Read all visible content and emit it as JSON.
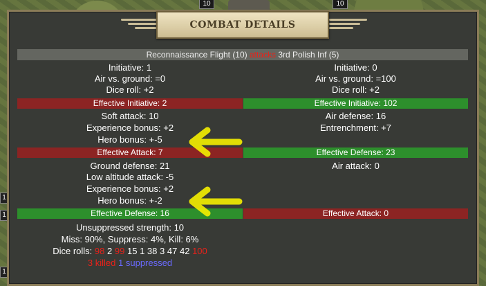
{
  "map": {
    "counters_top": [
      "10",
      "10"
    ],
    "side_counters": [
      "1",
      "1",
      "1"
    ]
  },
  "window": {
    "title": "COMBAT DETAILS"
  },
  "header": {
    "attacker": "Reconnaissance Flight (10)",
    "verb": "attacks",
    "defender": "3rd Polish Inf (5)"
  },
  "left": {
    "initiative": "Initiative: 1",
    "air_vs_ground": "Air vs. ground: =0",
    "dice_roll": "Dice roll: +2",
    "effective_initiative": "Effective Initiative: 2",
    "soft_attack": "Soft attack: 10",
    "experience_bonus": "Experience bonus: +2",
    "hero_bonus": "Hero bonus: +-5",
    "effective_attack": "Effective Attack: 7",
    "ground_defense": "Ground defense: 21",
    "low_altitude_attack": "Low altitude attack: -5",
    "experience_bonus_2": "Experience bonus: +2",
    "hero_bonus_2": "Hero bonus: +-2",
    "effective_defense": "Effective Defense: 16"
  },
  "right": {
    "initiative": "Initiative: 0",
    "air_vs_ground": "Air vs. ground: =100",
    "dice_roll": "Dice roll: +2",
    "effective_initiative": "Effective Initiative: 102",
    "air_defense": "Air defense: 16",
    "entrenchment": "Entrenchment: +7",
    "effective_defense": "Effective Defense: 23",
    "air_attack": "Air attack: 0",
    "effective_attack": "Effective Attack: 0"
  },
  "summary": {
    "unsuppressed": "Unsuppressed strength: 10",
    "odds": "Miss: 90%, Suppress: 4%, Kill: 6%",
    "dice_label": "Dice rolls:",
    "dice": [
      {
        "v": "98",
        "hit": true
      },
      {
        "v": "2",
        "hit": false
      },
      {
        "v": "99",
        "hit": true
      },
      {
        "v": "15",
        "hit": false
      },
      {
        "v": "1",
        "hit": false
      },
      {
        "v": "38",
        "hit": false
      },
      {
        "v": "3",
        "hit": false
      },
      {
        "v": "47",
        "hit": false
      },
      {
        "v": "42",
        "hit": false
      },
      {
        "v": "100",
        "hit": true
      }
    ],
    "killed": "3 killed",
    "suppressed": "1 suppressed"
  },
  "colors": {
    "red_bar": "#8c2423",
    "green_bar": "#2d8f2c",
    "arrow": "#f5f000"
  }
}
